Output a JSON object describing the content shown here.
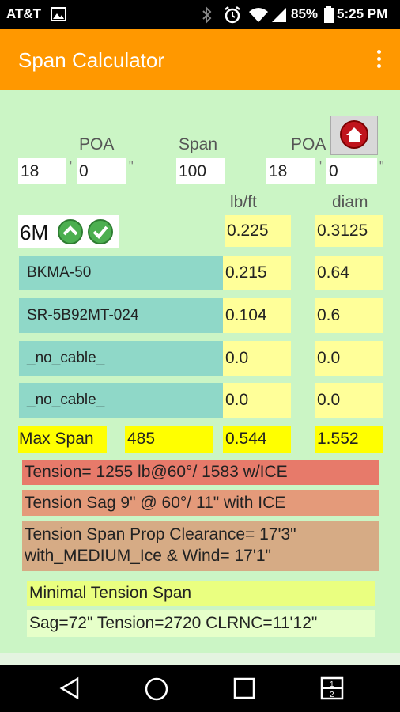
{
  "status_bar": {
    "carrier": "AT&T",
    "battery": "85%",
    "time": "5:25 PM"
  },
  "app_bar": {
    "title": "Span Calculator"
  },
  "colors": {
    "accent": "#ff9800",
    "background": "#cbf5c5",
    "input_yellow": "#ffff99",
    "cable_teal": "#8fd8c8",
    "bright_yellow": "#ffff00",
    "tension_red": "#e77a6a",
    "tension_orange": "#e49a7a",
    "clearance_tan": "#d6ab85"
  },
  "labels": {
    "poa_left": "POA",
    "span": "Span",
    "poa_right": "POA",
    "lbft": "lb/ft",
    "diam": "diam"
  },
  "inputs": {
    "left_ft": "18",
    "left_in": "0",
    "span": "100",
    "right_ft": "18",
    "right_in": "0",
    "ft_mark": "'",
    "in_mark": "\""
  },
  "strand": {
    "name": "6M",
    "lbft": "0.225",
    "diam": "0.3125"
  },
  "cables": [
    {
      "name": "BKMA-50",
      "lbft": "0.215",
      "diam": "0.64"
    },
    {
      "name": "SR-5B92MT-024",
      "lbft": "0.104",
      "diam": "0.6"
    },
    {
      "name": "_no_cable_",
      "lbft": "0.0",
      "diam": "0.0"
    },
    {
      "name": "_no_cable_",
      "lbft": "0.0",
      "diam": "0.0"
    }
  ],
  "max_span": {
    "label": "Max Span",
    "value": "485",
    "lbft": "0.544",
    "diam": "1.552"
  },
  "results": {
    "tension": "Tension= 1255 lb@60°/ 1583 w/ICE",
    "sag": "Tension Sag 9\" @ 60°/ 11\" with ICE",
    "clearance_line1": "Tension Span Prop Clearance= 17'3\"",
    "clearance_line2": "with_MEDIUM_Ice & Wind= 17'1\"",
    "minimal_title": "Minimal Tension Span",
    "minimal_detail": "Sag=72\" Tension=2720 CLRNC=11'12\""
  }
}
